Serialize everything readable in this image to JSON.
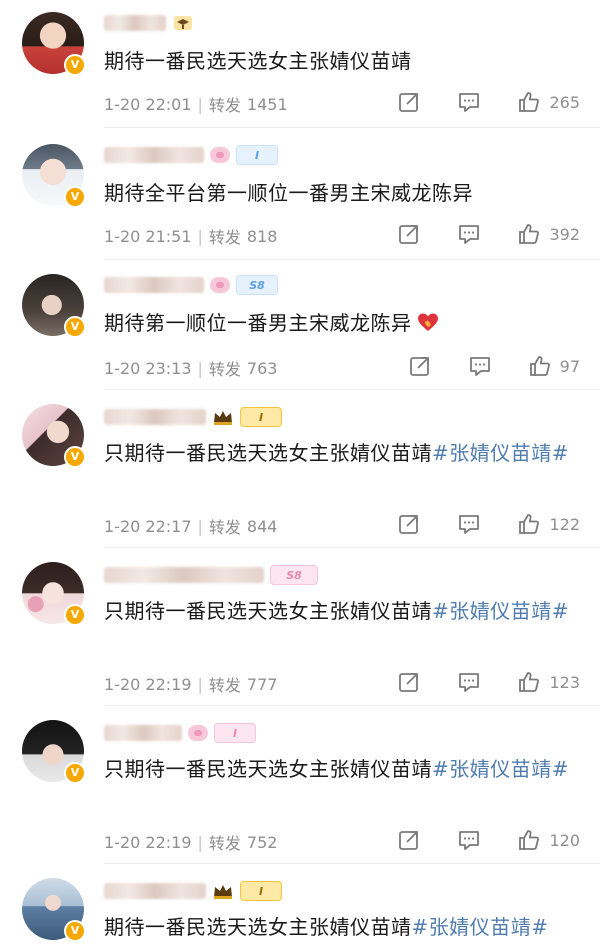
{
  "colors": {
    "hashtag": "#507daf",
    "meta_text": "#8f8f8f",
    "verified": "#f6a800"
  },
  "icons": {
    "share": "share-icon",
    "comment": "comment-icon",
    "like": "thumbs-up-icon",
    "verified": "verified-v-icon"
  },
  "comments": [
    {
      "text": "期待一番民选天选女主张婧仪苗靖",
      "hashtag": "",
      "time": "1-20 22:01",
      "repost_label": "转发",
      "reposts": "1451",
      "likes": "265",
      "badge": "",
      "name_icon": "graduation-hat"
    },
    {
      "text": "期待全平台第一顺位一番男主宋威龙陈异",
      "hashtag": "",
      "time": "1-20 21:51",
      "repost_label": "转发",
      "reposts": "818",
      "likes": "392",
      "badge": "I",
      "name_icon": "pig"
    },
    {
      "text": "期待第一顺位一番男主宋威龙陈异",
      "hashtag": "",
      "time": "1-20 23:13",
      "repost_label": "转发",
      "reposts": "763",
      "likes": "97",
      "badge": "S8",
      "name_icon": "pig"
    },
    {
      "text": "只期待一番民选天选女主张婧仪苗靖",
      "hashtag": "#张婧仪苗靖#",
      "time": "1-20 22:17",
      "repost_label": "转发",
      "reposts": "844",
      "likes": "122",
      "badge": "I",
      "name_icon": "crown"
    },
    {
      "text": "只期待一番民选天选女主张婧仪苗靖",
      "hashtag": "#张婧仪苗靖#",
      "time": "1-20 22:19",
      "repost_label": "转发",
      "reposts": "777",
      "likes": "123",
      "badge": "S8",
      "name_icon": "pig"
    },
    {
      "text": "只期待一番民选天选女主张婧仪苗靖",
      "hashtag": "#张婧仪苗靖#",
      "time": "1-20 22:19",
      "repost_label": "转发",
      "reposts": "752",
      "likes": "120",
      "badge": "I",
      "name_icon": "pig"
    },
    {
      "text": "期待一番民选天选女主张婧仪苗靖",
      "hashtag": "#张婧仪苗靖#",
      "badge": "I",
      "name_icon": "crown"
    }
  ]
}
